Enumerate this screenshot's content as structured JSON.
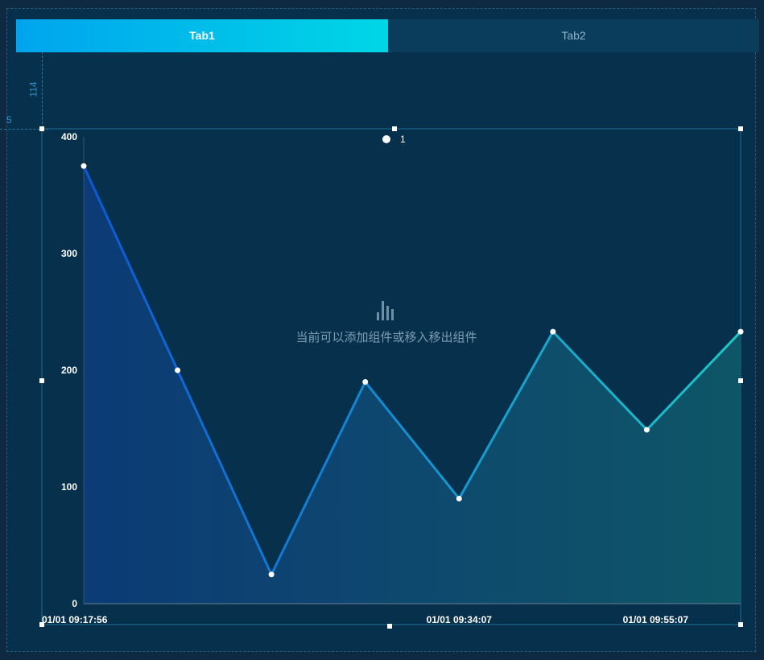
{
  "tabs": [
    {
      "label": "Tab1",
      "active": true
    },
    {
      "label": "Tab2",
      "active": false
    }
  ],
  "ruler": {
    "label": "114",
    "left_label": "5"
  },
  "selection_badge": "1",
  "empty_hint": "当前可以添加组件或移入移出组件",
  "colors": {
    "tab_active_start": "#00a4ee",
    "tab_active_end": "#00d6e6",
    "line_start": "#0d58d8",
    "line_end": "#1ec8c8",
    "marker": "#ffffff",
    "handle": "#ffffff"
  },
  "chart_data": {
    "type": "line",
    "x": [
      "01/01 09:17:56",
      "",
      "",
      "",
      "01/01 09:34:07",
      "",
      "01/01 09:55:07",
      ""
    ],
    "x_tick_labels": [
      "01/01 09:17:56",
      "01/01 09:34:07",
      "01/01 09:55:07"
    ],
    "values": [
      375,
      200,
      25,
      190,
      90,
      233,
      149,
      233
    ],
    "ylim": [
      0,
      400
    ],
    "y_ticks": [
      0,
      100,
      200,
      300,
      400
    ],
    "grid": false,
    "legend": "none",
    "area_fill": true
  }
}
